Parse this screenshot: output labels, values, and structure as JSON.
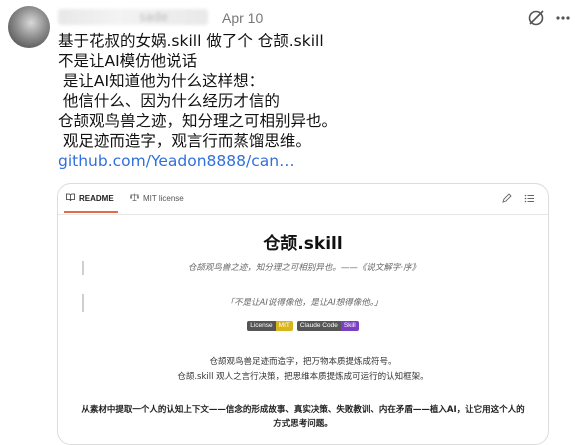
{
  "post": {
    "author_name_blurred": "sade",
    "date": "Apr 10",
    "lines": [
      "基于花叔的女娲.skill 做了个 仓颉.skill",
      "不是让AI模仿他说话",
      " 是让AI知道他为什么这样想：",
      " 他信什么、因为什么经历才信的",
      "仓颉观鸟兽之迹，知分理之可相别异也。",
      " 观足迹而造字，观言行而蒸馏思维。"
    ],
    "link": "github.com/Yeadon8888/can…"
  },
  "icons": {
    "mute": "mute-icon",
    "more": "more-icon",
    "readme": "book-icon",
    "license": "scale-icon",
    "edit": "pencil-icon",
    "toc": "list-icon"
  },
  "card": {
    "tabs": {
      "readme": "README",
      "license": "MIT license"
    },
    "title": "仓颉.skill",
    "quote1": "仓颉观鸟兽之迹，知分理之可相别异也。——《说文解字·序》",
    "quote2": "「不是让AI说得像他，是让AI想得像他。」",
    "badges": [
      {
        "key": "License",
        "value": "MIT",
        "color": "#d8b51e"
      },
      {
        "key": "Claude Code",
        "value": "Skill",
        "color": "#7a3fc2"
      }
    ],
    "desc1": "仓颉观鸟兽足迹而造字，把万物本质提炼成符号。",
    "desc2": "仓颉.skill 观人之言行决策，把思维本质提炼成可运行的认知框架。",
    "para": "从素材中提取一个人的认知上下文——信念的形成故事、真实决策、失败教训、内在矛盾——植入AI，让它用这个人的方式思考问题。"
  }
}
